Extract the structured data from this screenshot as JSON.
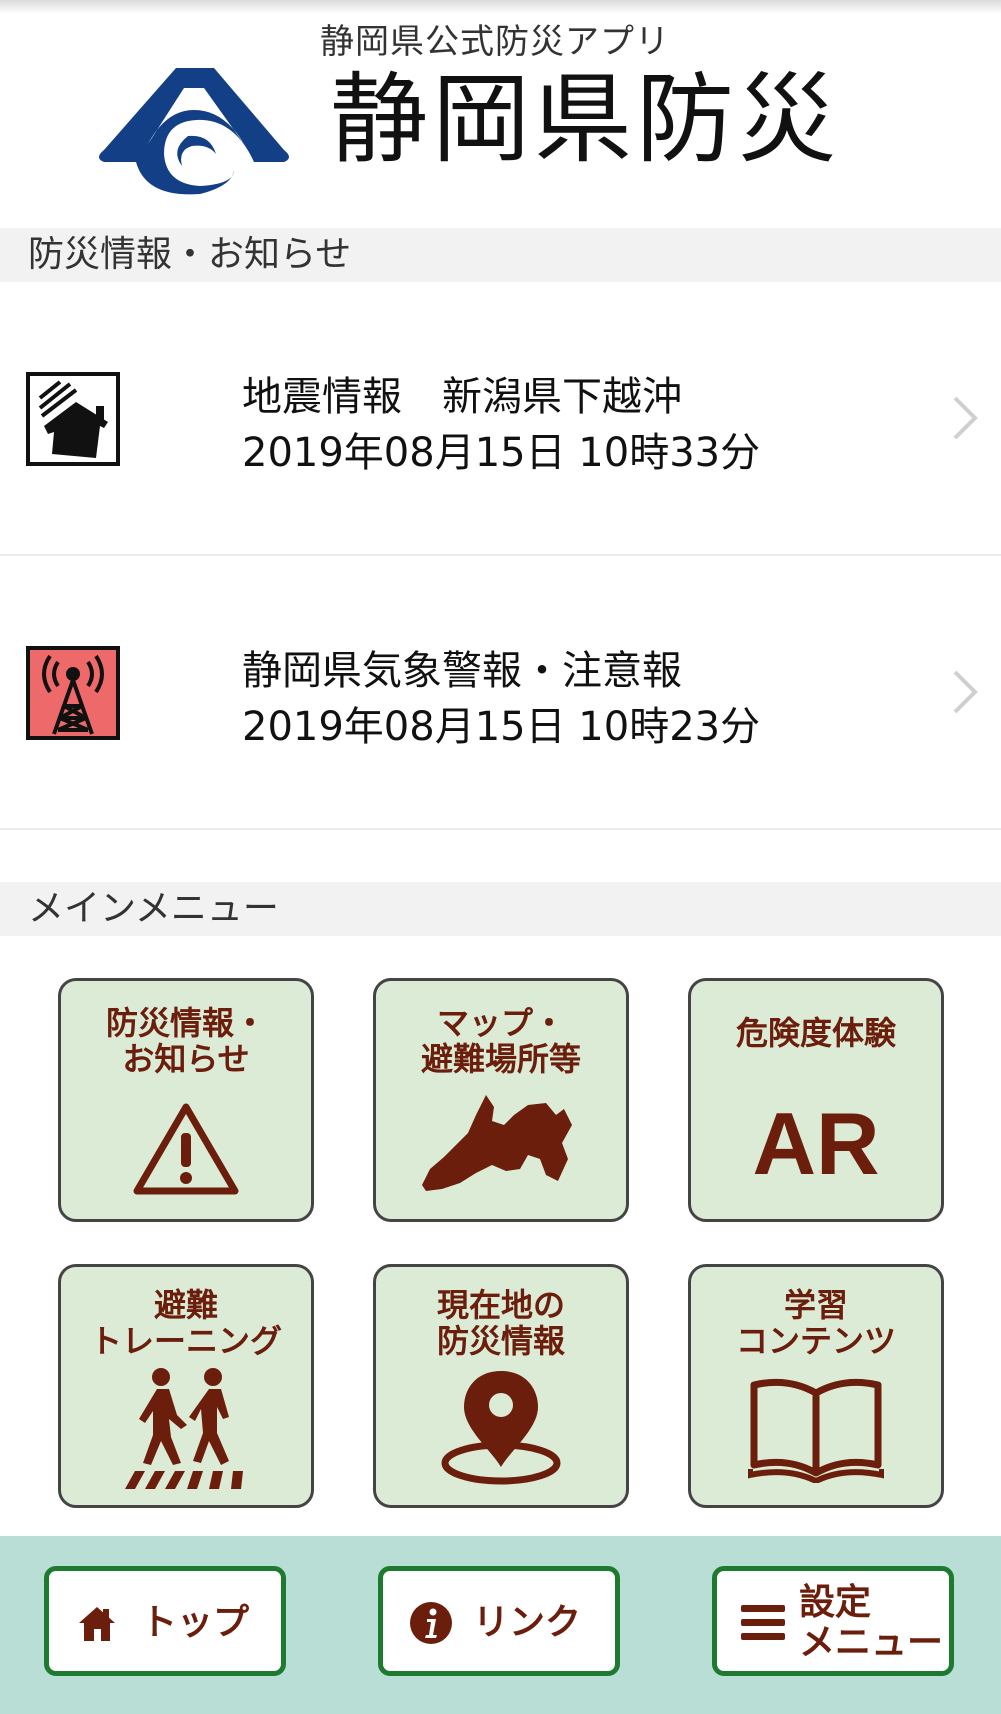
{
  "header": {
    "subtitle": "静岡県公式防災アプリ",
    "logo_text": "静岡県防災"
  },
  "sections": {
    "news_title": "防災情報・お知らせ",
    "menu_title": "メインメニュー"
  },
  "news": [
    {
      "title": "地震情報　新潟県下越沖",
      "date": "2019年08月15日 10時33分",
      "icon": "earthquake-house-icon"
    },
    {
      "title": "静岡県気象警報・注意報",
      "date": "2019年08月15日 10時23分",
      "icon": "warning-tower-icon"
    }
  ],
  "menu": [
    {
      "label": "防災情報・\nお知らせ",
      "icon": "warning-triangle-icon"
    },
    {
      "label": "マップ・\n避難場所等",
      "icon": "shizuoka-map-icon"
    },
    {
      "label": "危険度体験",
      "ar": "AR",
      "icon": "ar-icon"
    },
    {
      "label": "避難\nトレーニング",
      "icon": "walking-people-icon"
    },
    {
      "label": "現在地の\n防災情報",
      "icon": "location-pin-icon"
    },
    {
      "label": "学習\nコンテンツ",
      "icon": "open-book-icon"
    }
  ],
  "bottom_nav": {
    "top": "トップ",
    "link": "リンク",
    "settings": "設定\nメニュー"
  },
  "colors": {
    "tile_bg": "#dcebd6",
    "accent_brown": "#6b1e0c",
    "nav_bg": "#b9ded6",
    "nav_border": "#1d7a2f",
    "logo_blue": "#123f86",
    "alert_red": "#ee6a6a"
  }
}
